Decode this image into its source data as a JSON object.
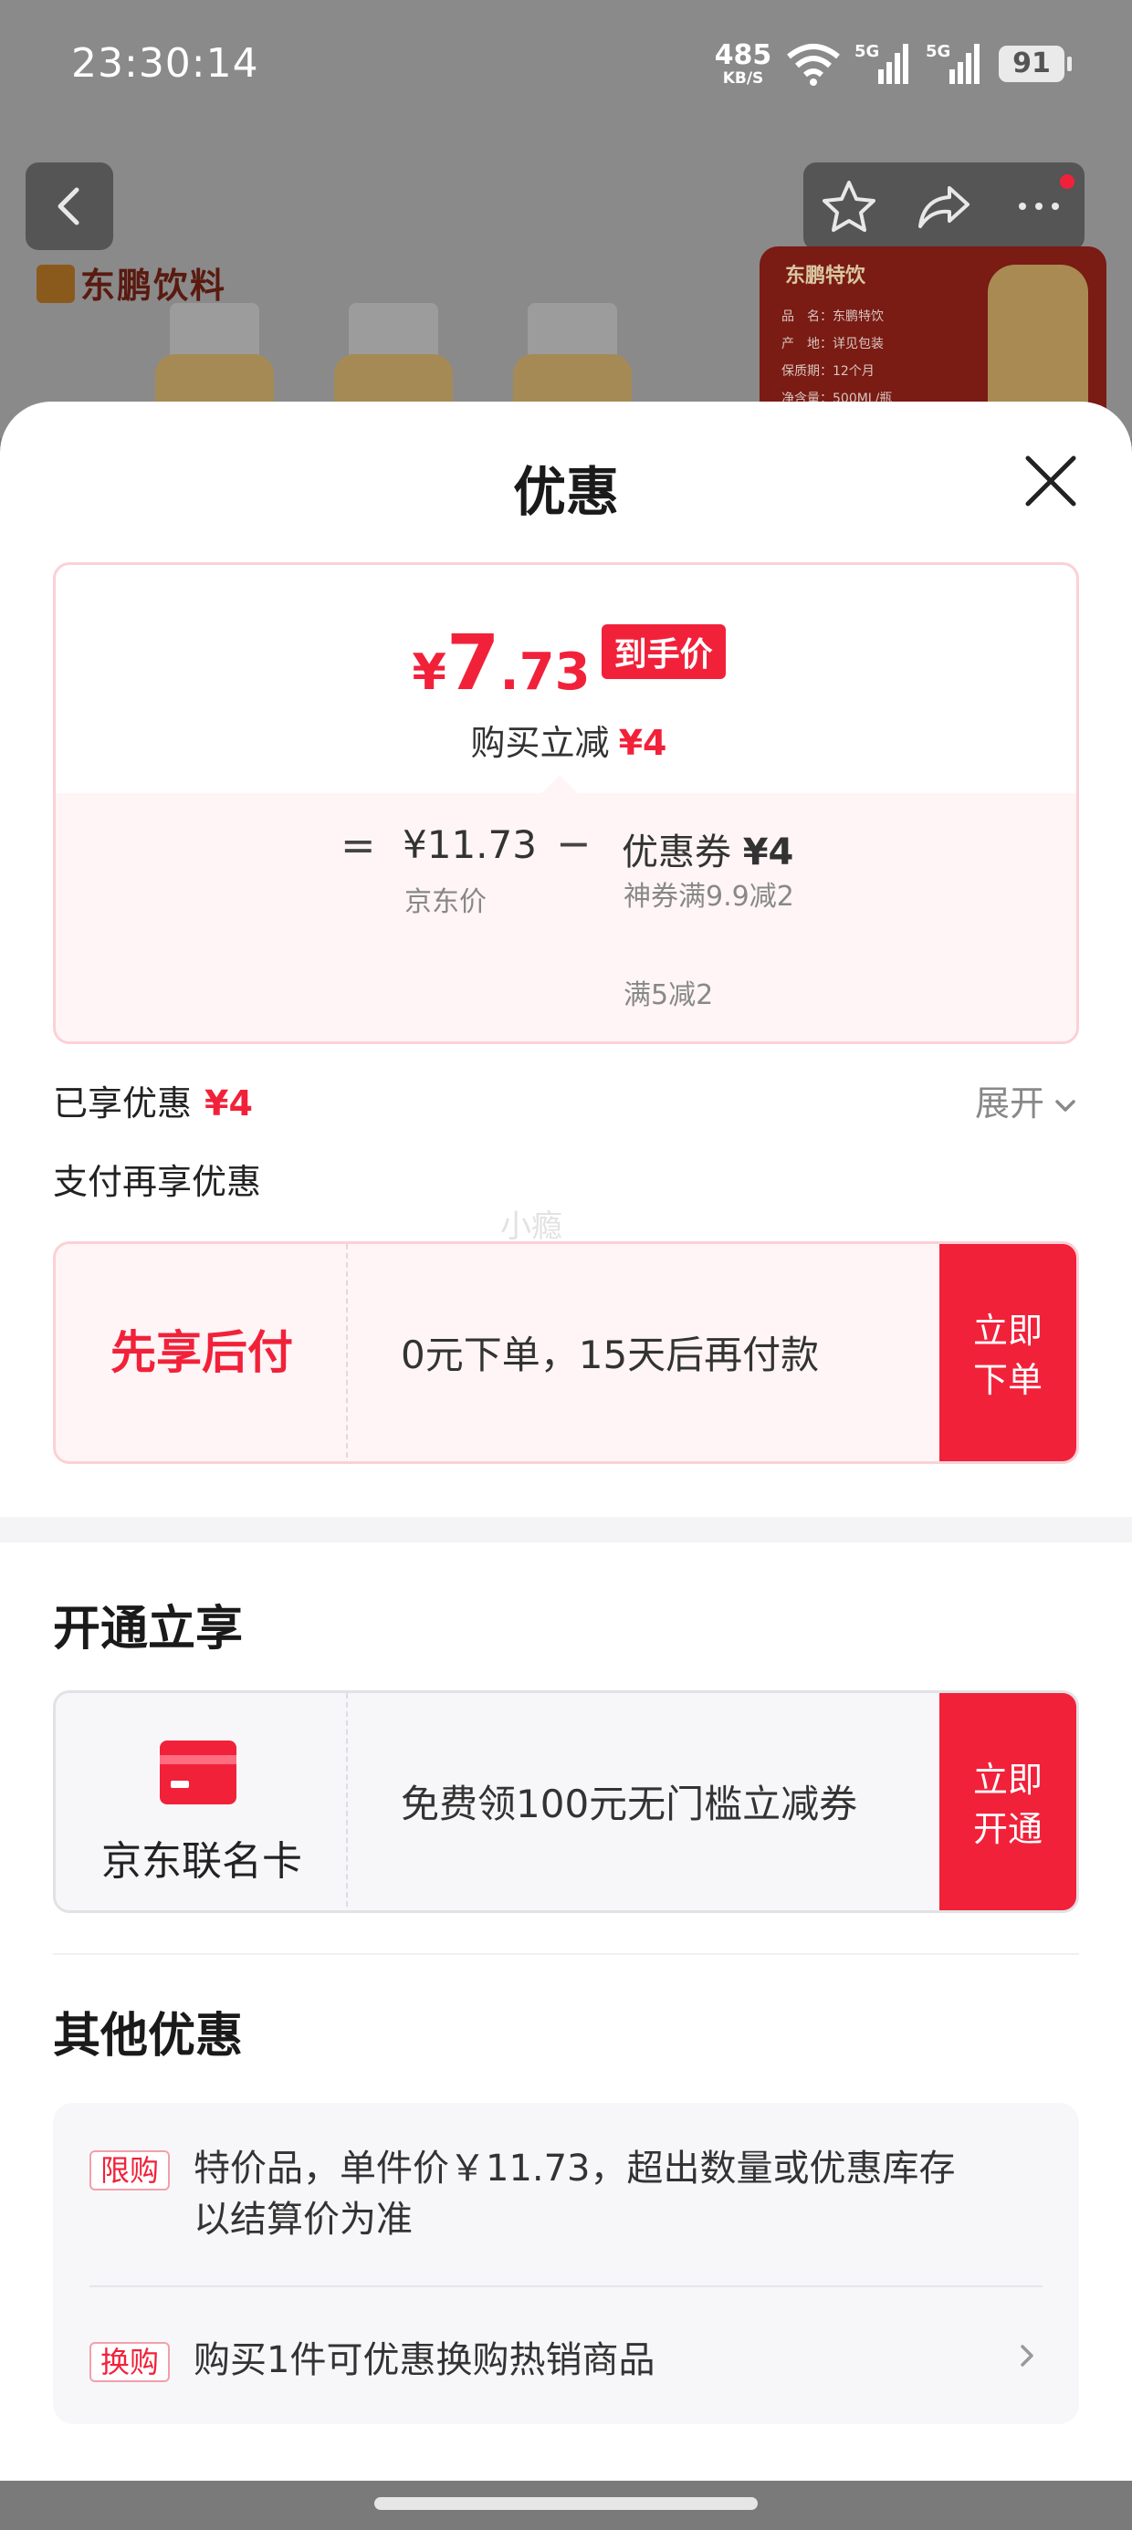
{
  "status_bar": {
    "time": "23:30:14",
    "net_speed": "485",
    "net_unit": "KB/S",
    "signal_1": "5G",
    "signal_2": "5G",
    "battery": "91"
  },
  "background": {
    "brand": "东鹏饮料",
    "spec_title": "东鹏特饮",
    "spec_rows": [
      "品　名：东鹏特饮",
      "产　地：详见包装",
      "保质期：12个月",
      "净含量：500ML/瓶"
    ]
  },
  "sheet": {
    "title": "优惠",
    "price": {
      "yen": "¥",
      "integer": "7",
      "decimal": ".73",
      "tag": "到手价",
      "reduce_label": "购买立减",
      "reduce_amount": "¥4"
    },
    "formula": {
      "equals": "=",
      "base_price": "¥11.73",
      "base_label": "京东价",
      "minus": "−",
      "coupon_label": "优惠券",
      "coupon_amount": "¥4",
      "coupon_detail_1": "神券满9.9减2",
      "coupon_detail_2": "满5减2"
    },
    "enjoyed": {
      "label": "已享优惠",
      "amount": "¥4",
      "expand": "展开"
    },
    "pay_section_label": "支付再享优惠",
    "watermark": "小瘾",
    "bnpl": {
      "title": "先享后付",
      "desc": "0元下单，15天后再付款",
      "button_line1": "立即",
      "button_line2": "下单"
    },
    "open_section": {
      "title": "开通立享",
      "card_name": "京东联名卡",
      "desc": "免费领100元无门槛立减券",
      "button_line1": "立即",
      "button_line2": "开通"
    },
    "other_section": {
      "title": "其他优惠",
      "items": [
        {
          "tag": "限购",
          "text_line1": "特价品，单件价￥11.73，超出数量或优惠库存",
          "text_line2": "以结算价为准"
        },
        {
          "tag": "换购",
          "text_line1": "购买1件可优惠换购热销商品"
        }
      ]
    }
  },
  "colors": {
    "accent": "#f2213a",
    "accent_light_bg": "#fff5f6",
    "card_border": "#fbd1d6"
  }
}
